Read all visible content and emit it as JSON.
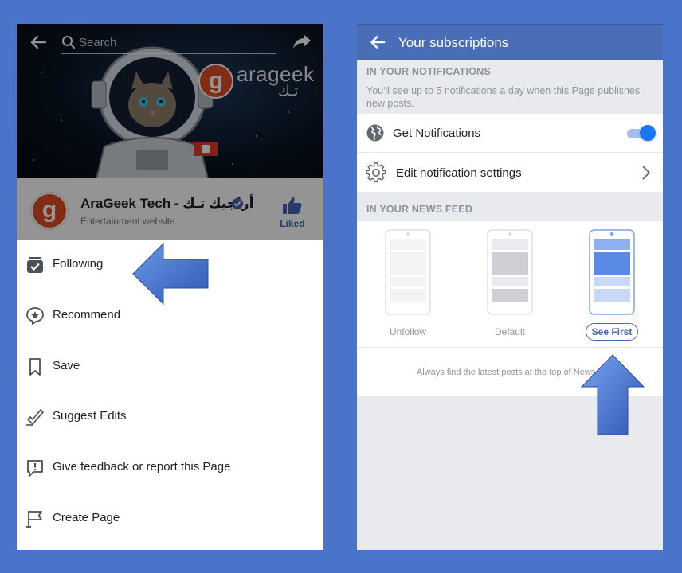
{
  "left_panel": {
    "search": {
      "placeholder": "Search"
    },
    "brand": {
      "letter": "g",
      "name": "arageek",
      "arabic": "تـك"
    },
    "page": {
      "avatar_letter": "g",
      "name": "AraGeek Tech - أراجيك تـك",
      "category": "Entertainment website",
      "liked_label": "Liked"
    },
    "menu": [
      {
        "label": "Following",
        "icon": "following-check-icon"
      },
      {
        "label": "Recommend",
        "icon": "recommend-star-icon"
      },
      {
        "label": "Save",
        "icon": "bookmark-icon"
      },
      {
        "label": "Suggest Edits",
        "icon": "pencil-icon"
      },
      {
        "label": "Give feedback or report this Page",
        "icon": "feedback-alert-icon"
      },
      {
        "label": "Create Page",
        "icon": "flag-icon"
      }
    ]
  },
  "right_panel": {
    "title": "Your subscriptions",
    "notifications": {
      "section_label": "IN YOUR NOTIFICATIONS",
      "description": "You'll see up to 5 notifications a day when this Page publishes new posts.",
      "get_notifications_label": "Get Notifications",
      "get_notifications_on": true,
      "edit_settings_label": "Edit notification settings"
    },
    "news_feed": {
      "section_label": "IN YOUR NEWS FEED",
      "options": [
        {
          "label": "Unfollow",
          "selected": false
        },
        {
          "label": "Default",
          "selected": false
        },
        {
          "label": "See First",
          "selected": true
        }
      ],
      "hint": "Always find the latest posts at the top of News F"
    }
  },
  "colors": {
    "background": "#4a74c9",
    "header_blue": "#4a6db7",
    "fb_blue": "#4267b2",
    "toggle_blue": "#1877f2",
    "brand_orange": "#e14b25"
  }
}
